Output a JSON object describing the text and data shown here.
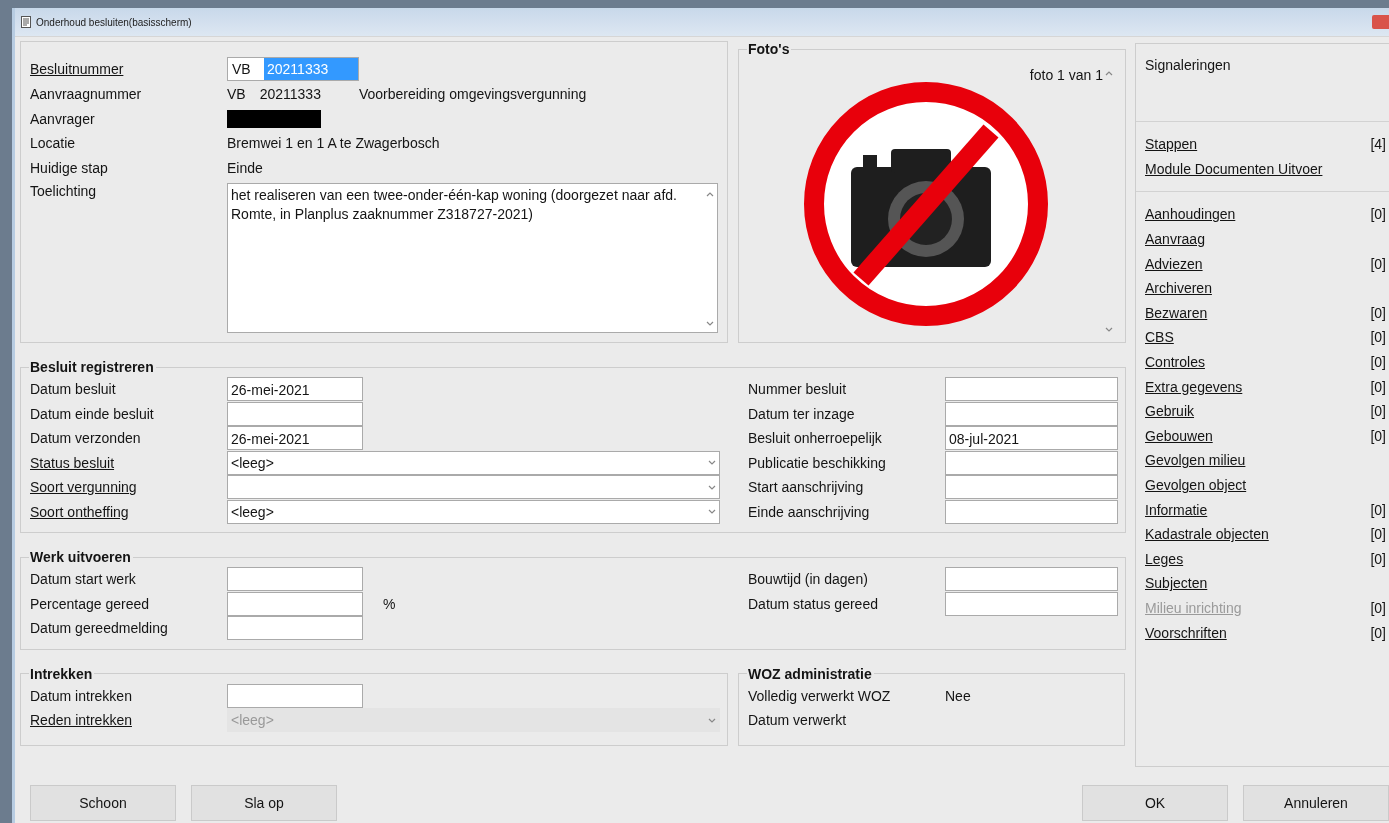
{
  "window": {
    "title": "Onderhoud besluiten(basisscherm)"
  },
  "details": [
    {
      "kind": "prefix-input",
      "label": "Besluitnummer",
      "link": true,
      "prefix": "VB",
      "value": "20211333",
      "value_selected": true
    },
    {
      "kind": "text",
      "label": "Aanvraagnummer",
      "link": false,
      "parts": [
        "VB",
        "20211333",
        "Voorbereiding omgevingsvergunning"
      ]
    },
    {
      "kind": "redacted",
      "label": "Aanvrager",
      "link": false
    },
    {
      "kind": "text",
      "label": "Locatie",
      "link": false,
      "parts": [
        "Bremwei 1 en 1 A te Zwagerbosch"
      ]
    },
    {
      "kind": "text",
      "label": "Huidige stap",
      "link": false,
      "parts": [
        "Einde"
      ]
    },
    {
      "kind": "textarea",
      "label": "Toelichting",
      "link": false,
      "value": "het realiseren van een twee-onder-één-kap woning (doorgezet naar afd. Romte, in Planplus zaaknummer Z318727-2021)"
    }
  ],
  "photos": {
    "title": "Foto's",
    "counter": "foto 1 van 1"
  },
  "sections": [
    {
      "title": "Besluit registreren",
      "left": [
        {
          "kind": "date",
          "label": "Datum besluit",
          "link": false,
          "value": "26-mei-2021"
        },
        {
          "kind": "date",
          "label": "Datum einde besluit",
          "link": false
        },
        {
          "kind": "date",
          "label": "Datum verzonden",
          "link": false,
          "value": "26-mei-2021"
        },
        {
          "kind": "select",
          "label": "Status besluit",
          "link": true,
          "value": "<leeg>",
          "disabled": false
        },
        {
          "kind": "select",
          "label": "Soort vergunning",
          "link": true,
          "disabled": false
        },
        {
          "kind": "select",
          "label": "Soort ontheffing",
          "link": true,
          "value": "<leeg>",
          "disabled": false
        }
      ],
      "right": [
        {
          "kind": "input",
          "label": "Nummer besluit",
          "link": false
        },
        {
          "kind": "input",
          "label": "Datum ter inzage",
          "link": false
        },
        {
          "kind": "input",
          "label": "Besluit onherroepelijk",
          "link": false,
          "value": "08-jul-2021"
        },
        {
          "kind": "input",
          "label": "Publicatie beschikking",
          "link": false
        },
        {
          "kind": "input",
          "label": "Start aanschrijving",
          "link": false
        },
        {
          "kind": "input",
          "label": "Einde aanschrijving",
          "link": false
        }
      ]
    },
    {
      "title": "Werk uitvoeren",
      "left": [
        {
          "kind": "date",
          "label": "Datum start werk",
          "link": false
        },
        {
          "kind": "date",
          "label": "Percentage gereed",
          "link": false,
          "unit": "%"
        },
        {
          "kind": "date",
          "label": "Datum gereedmelding",
          "link": false
        }
      ],
      "right": [
        {
          "kind": "input",
          "label": "Bouwtijd (in dagen)",
          "link": false
        },
        {
          "kind": "input",
          "label": "Datum status gereed",
          "link": false
        }
      ]
    }
  ],
  "bottom_sections": [
    {
      "title": "Intrekken",
      "rows": [
        {
          "kind": "date",
          "label": "Datum intrekken",
          "link": false
        },
        {
          "kind": "select",
          "label": "Reden intrekken",
          "link": true,
          "value": "<leeg>",
          "disabled": true
        }
      ]
    },
    {
      "title": "WOZ administratie",
      "rows": [
        {
          "kind": "static",
          "label": "Volledig verwerkt WOZ",
          "link": false,
          "value": "Nee"
        },
        {
          "kind": "static",
          "label": "Datum verwerkt",
          "link": false
        }
      ]
    }
  ],
  "side_panel": {
    "signals_label": "Signaleringen",
    "groups": [
      [
        {
          "label": "Stappen",
          "count": "[4]",
          "disabled": false
        },
        {
          "label": "Module Documenten Uitvoer",
          "disabled": false
        }
      ],
      [
        {
          "label": "Aanhoudingen",
          "count": "[0]",
          "disabled": false
        },
        {
          "label": "Aanvraag",
          "disabled": false
        },
        {
          "label": "Adviezen",
          "count": "[0]",
          "disabled": false
        },
        {
          "label": "Archiveren",
          "disabled": false
        },
        {
          "label": "Bezwaren",
          "count": "[0]",
          "disabled": false
        },
        {
          "label": "CBS",
          "count": "[0]",
          "disabled": false
        },
        {
          "label": "Controles",
          "count": "[0]",
          "disabled": false
        },
        {
          "label": "Extra gegevens",
          "count": "[0]",
          "disabled": false
        },
        {
          "label": "Gebruik",
          "count": "[0]",
          "disabled": false
        },
        {
          "label": "Gebouwen",
          "count": "[0]",
          "disabled": false
        },
        {
          "label": "Gevolgen milieu",
          "disabled": false
        },
        {
          "label": "Gevolgen object",
          "disabled": false
        },
        {
          "label": "Informatie",
          "count": "[0]",
          "disabled": false
        },
        {
          "label": "Kadastrale objecten",
          "count": "[0]",
          "disabled": false
        },
        {
          "label": "Leges",
          "count": "[0]",
          "disabled": false
        },
        {
          "label": "Subjecten",
          "disabled": false
        },
        {
          "label": "Milieu inrichting",
          "count": "[0]",
          "disabled": true
        },
        {
          "label": "Voorschriften",
          "count": "[0]",
          "disabled": false
        }
      ]
    ]
  },
  "buttons_left": [
    "Schoon",
    "Sla op"
  ],
  "buttons_right": [
    "OK",
    "Annuleren"
  ]
}
